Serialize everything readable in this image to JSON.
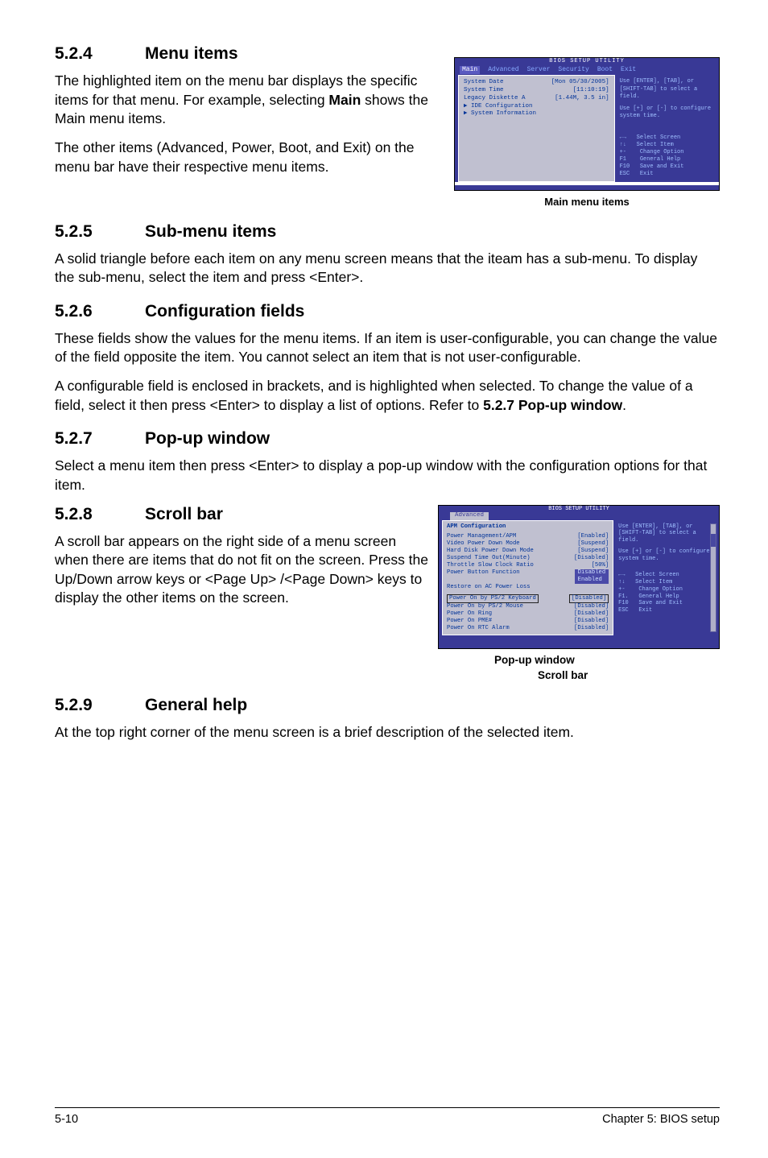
{
  "s524": {
    "num": "5.2.4",
    "title": "Menu items",
    "p1a": "The highlighted item on the menu bar displays the specific items for that menu. For example, selecting ",
    "p1bold": "Main",
    "p1b": " shows the Main menu items.",
    "p2": "The other items (Advanced, Power, Boot, and Exit) on the menu bar have their respective menu items."
  },
  "fig1": {
    "title": "BIOS SETUP UTILITY",
    "tabs": [
      "Main",
      "Advanced",
      "Server",
      "Security",
      "Boot",
      "Exit"
    ],
    "rows": [
      {
        "l": "System Date",
        "v": "[Mon 05/30/2005]"
      },
      {
        "l": "System Time",
        "v": "[11:10:19]"
      },
      {
        "l": "",
        "v": ""
      },
      {
        "l": "Legacy Diskette A",
        "v": "[1.44M, 3.5 in]"
      },
      {
        "l": "",
        "v": ""
      },
      {
        "l": "▶ IDE Configuration",
        "v": ""
      },
      {
        "l": "▶ System Information",
        "v": ""
      }
    ],
    "help1": "Use [ENTER], [TAB], or [SHIFT-TAB] to select a field.",
    "help2": "Use [+] or [-] to configure system time.",
    "keys": "←→   Select Screen\n↑↓   Select Item\n+-    Change Option\nF1    General Help\nF10   Save and Exit\nESC   Exit",
    "caption": "Main menu items"
  },
  "s525": {
    "num": "5.2.5",
    "title": "Sub-menu items",
    "p": "A solid triangle before each item on any menu screen means that the iteam has a sub-menu. To display the sub-menu, select the item and press <Enter>."
  },
  "s526": {
    "num": "5.2.6",
    "title": "Configuration fields",
    "p1": "These fields show the values for the menu items. If an item is user-configurable, you can change the value of the field opposite the item. You cannot select an item that is not user-configurable.",
    "p2a": "A configurable field is enclosed in brackets, and is highlighted when selected. To change the value of a field, select it then press <Enter> to display a list of options. Refer to ",
    "p2bold": "5.2.7 Pop-up window",
    "p2b": "."
  },
  "s527": {
    "num": "5.2.7",
    "title": "Pop-up window",
    "p": "Select a menu item then press <Enter> to display a pop-up window with the configuration options for that item."
  },
  "s528": {
    "num": "5.2.8",
    "title": "Scroll bar",
    "p": "A scroll bar appears on the right side of a menu screen when there are items that do not fit on the screen. Press the Up/Down arrow keys or <Page Up> /<Page Down> keys to display the other items on the screen."
  },
  "fig2": {
    "title": "BIOS SETUP UTILITY",
    "tab": "Advanced",
    "head": "APM Configuration",
    "rows": [
      {
        "l": "Power Management/APM",
        "v": "[Enabled]"
      },
      {
        "l": "Video Power Down Mode",
        "v": "[Suspend]"
      },
      {
        "l": "Hard Disk Power Down Mode",
        "v": "[Suspend]"
      },
      {
        "l": "Suspend Time Out(Minute)",
        "v": "[Disabled]"
      },
      {
        "l": "Throttle Slow Clock Ratio",
        "v": "[50%]"
      },
      {
        "l": "Power Button Function",
        "v": ""
      },
      {
        "l": "Restore on AC Power Loss",
        "v": ""
      }
    ],
    "popupopts": [
      "Disabled",
      "Enabled"
    ],
    "rows2": [
      {
        "l": "Power On by PS/2 Keyboard",
        "v": "[Disabled]",
        "sel": true
      },
      {
        "l": "Power On by PS/2 Mouse",
        "v": "[Disabled]"
      },
      {
        "l": "Power On Ring",
        "v": "[Disabled]"
      },
      {
        "l": "Power On PME#",
        "v": "[Disabled]"
      },
      {
        "l": "Power On RTC Alarm",
        "v": "[Disabled]"
      }
    ],
    "help1": "Use [ENTER], [TAB], or [SHIFT-TAB] to select a field.",
    "help2": "Use [+] or [-] to configure system time.",
    "keys": "←→   Select Screen\n↑↓   Select Item\n+-    Change Option\nF1.   General Help\nF10   Save and Exit\nESC   Exit",
    "cap_popup": "Pop-up window",
    "cap_scroll": "Scroll bar"
  },
  "s529": {
    "num": "5.2.9",
    "title": "General help",
    "p": "At the top right corner of the menu screen is a brief description of the selected item."
  },
  "footer": {
    "left": "5-10",
    "right": "Chapter 5: BIOS setup"
  }
}
